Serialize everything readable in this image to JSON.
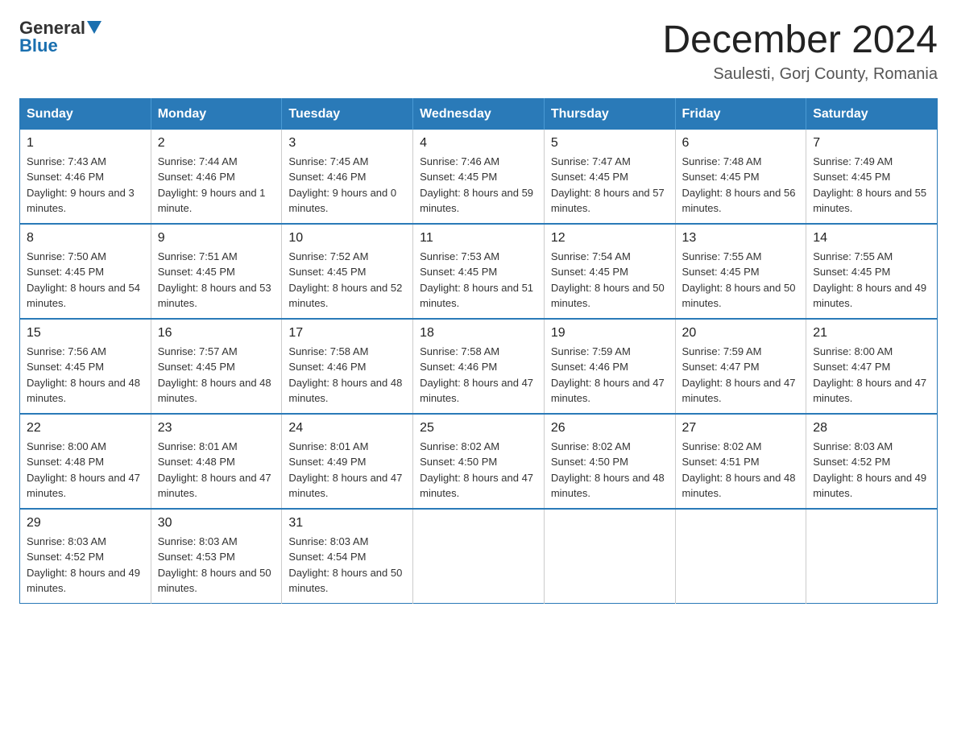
{
  "header": {
    "logo_general": "General",
    "logo_blue": "Blue",
    "month_title": "December 2024",
    "location": "Saulesti, Gorj County, Romania"
  },
  "days_of_week": [
    "Sunday",
    "Monday",
    "Tuesday",
    "Wednesday",
    "Thursday",
    "Friday",
    "Saturday"
  ],
  "weeks": [
    [
      {
        "day": "1",
        "sunrise": "7:43 AM",
        "sunset": "4:46 PM",
        "daylight": "9 hours and 3 minutes."
      },
      {
        "day": "2",
        "sunrise": "7:44 AM",
        "sunset": "4:46 PM",
        "daylight": "9 hours and 1 minute."
      },
      {
        "day": "3",
        "sunrise": "7:45 AM",
        "sunset": "4:46 PM",
        "daylight": "9 hours and 0 minutes."
      },
      {
        "day": "4",
        "sunrise": "7:46 AM",
        "sunset": "4:45 PM",
        "daylight": "8 hours and 59 minutes."
      },
      {
        "day": "5",
        "sunrise": "7:47 AM",
        "sunset": "4:45 PM",
        "daylight": "8 hours and 57 minutes."
      },
      {
        "day": "6",
        "sunrise": "7:48 AM",
        "sunset": "4:45 PM",
        "daylight": "8 hours and 56 minutes."
      },
      {
        "day": "7",
        "sunrise": "7:49 AM",
        "sunset": "4:45 PM",
        "daylight": "8 hours and 55 minutes."
      }
    ],
    [
      {
        "day": "8",
        "sunrise": "7:50 AM",
        "sunset": "4:45 PM",
        "daylight": "8 hours and 54 minutes."
      },
      {
        "day": "9",
        "sunrise": "7:51 AM",
        "sunset": "4:45 PM",
        "daylight": "8 hours and 53 minutes."
      },
      {
        "day": "10",
        "sunrise": "7:52 AM",
        "sunset": "4:45 PM",
        "daylight": "8 hours and 52 minutes."
      },
      {
        "day": "11",
        "sunrise": "7:53 AM",
        "sunset": "4:45 PM",
        "daylight": "8 hours and 51 minutes."
      },
      {
        "day": "12",
        "sunrise": "7:54 AM",
        "sunset": "4:45 PM",
        "daylight": "8 hours and 50 minutes."
      },
      {
        "day": "13",
        "sunrise": "7:55 AM",
        "sunset": "4:45 PM",
        "daylight": "8 hours and 50 minutes."
      },
      {
        "day": "14",
        "sunrise": "7:55 AM",
        "sunset": "4:45 PM",
        "daylight": "8 hours and 49 minutes."
      }
    ],
    [
      {
        "day": "15",
        "sunrise": "7:56 AM",
        "sunset": "4:45 PM",
        "daylight": "8 hours and 48 minutes."
      },
      {
        "day": "16",
        "sunrise": "7:57 AM",
        "sunset": "4:45 PM",
        "daylight": "8 hours and 48 minutes."
      },
      {
        "day": "17",
        "sunrise": "7:58 AM",
        "sunset": "4:46 PM",
        "daylight": "8 hours and 48 minutes."
      },
      {
        "day": "18",
        "sunrise": "7:58 AM",
        "sunset": "4:46 PM",
        "daylight": "8 hours and 47 minutes."
      },
      {
        "day": "19",
        "sunrise": "7:59 AM",
        "sunset": "4:46 PM",
        "daylight": "8 hours and 47 minutes."
      },
      {
        "day": "20",
        "sunrise": "7:59 AM",
        "sunset": "4:47 PM",
        "daylight": "8 hours and 47 minutes."
      },
      {
        "day": "21",
        "sunrise": "8:00 AM",
        "sunset": "4:47 PM",
        "daylight": "8 hours and 47 minutes."
      }
    ],
    [
      {
        "day": "22",
        "sunrise": "8:00 AM",
        "sunset": "4:48 PM",
        "daylight": "8 hours and 47 minutes."
      },
      {
        "day": "23",
        "sunrise": "8:01 AM",
        "sunset": "4:48 PM",
        "daylight": "8 hours and 47 minutes."
      },
      {
        "day": "24",
        "sunrise": "8:01 AM",
        "sunset": "4:49 PM",
        "daylight": "8 hours and 47 minutes."
      },
      {
        "day": "25",
        "sunrise": "8:02 AM",
        "sunset": "4:50 PM",
        "daylight": "8 hours and 47 minutes."
      },
      {
        "day": "26",
        "sunrise": "8:02 AM",
        "sunset": "4:50 PM",
        "daylight": "8 hours and 48 minutes."
      },
      {
        "day": "27",
        "sunrise": "8:02 AM",
        "sunset": "4:51 PM",
        "daylight": "8 hours and 48 minutes."
      },
      {
        "day": "28",
        "sunrise": "8:03 AM",
        "sunset": "4:52 PM",
        "daylight": "8 hours and 49 minutes."
      }
    ],
    [
      {
        "day": "29",
        "sunrise": "8:03 AM",
        "sunset": "4:52 PM",
        "daylight": "8 hours and 49 minutes."
      },
      {
        "day": "30",
        "sunrise": "8:03 AM",
        "sunset": "4:53 PM",
        "daylight": "8 hours and 50 minutes."
      },
      {
        "day": "31",
        "sunrise": "8:03 AM",
        "sunset": "4:54 PM",
        "daylight": "8 hours and 50 minutes."
      },
      null,
      null,
      null,
      null
    ]
  ]
}
